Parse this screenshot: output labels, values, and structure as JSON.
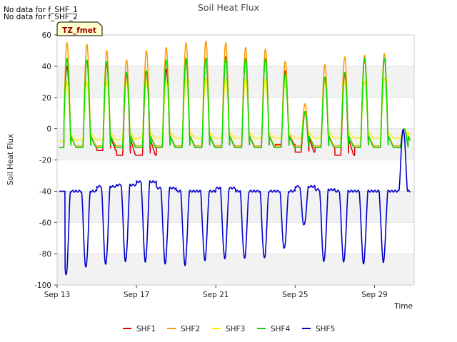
{
  "notes": [
    "No data for f_SHF_1",
    "No data for f_SHF_2"
  ],
  "badge": "TZ_fmet",
  "chart_data": {
    "type": "line",
    "title": "Soil Heat Flux",
    "xlabel": "Time",
    "ylabel": "Soil Heat Flux",
    "ylim": [
      -100,
      60
    ],
    "yticks": [
      -100,
      -80,
      -60,
      -40,
      -20,
      0,
      20,
      40,
      60
    ],
    "xlim": [
      "2023-09-13",
      "2023-10-01"
    ],
    "xticks": [
      "Sep 13",
      "Sep 17",
      "Sep 21",
      "Sep 25",
      "Sep 29"
    ],
    "xtick_dates": [
      "2023-09-13",
      "2023-09-17",
      "2023-09-21",
      "2023-09-25",
      "2023-09-29"
    ],
    "grid": "horizontal bands",
    "legend_position": "bottom",
    "series": [
      {
        "name": "SHF1",
        "color": "#dd0000",
        "daily_min": [
          -12,
          -12,
          -14,
          -17,
          -17,
          -12,
          -12,
          -12,
          -12,
          -12,
          -12,
          -10,
          -15,
          -12,
          -17,
          -12,
          -12,
          -12
        ],
        "daily_max": [
          40,
          44,
          42,
          35,
          37,
          38,
          44,
          45,
          46,
          45,
          45,
          37,
          10,
          33,
          35,
          45,
          45,
          0
        ]
      },
      {
        "name": "SHF2",
        "color": "#ff9900",
        "daily_min": [
          -12,
          -11,
          -11,
          -11,
          -11,
          -11,
          -11,
          -11,
          -11,
          -11,
          -11,
          -11,
          -11,
          -11,
          -11,
          -11,
          -11,
          -11
        ],
        "daily_max": [
          55,
          54,
          50,
          44,
          50,
          52,
          55,
          56,
          55,
          52,
          51,
          43,
          16,
          41,
          46,
          47,
          48,
          0
        ]
      },
      {
        "name": "SHF3",
        "color": "#ffee00",
        "daily_min": [
          -8,
          -7,
          -7,
          -7,
          -6,
          -6,
          -6,
          -6,
          -6,
          -6,
          -6,
          -6,
          -6,
          -6,
          -6,
          -6,
          -6,
          -6
        ],
        "daily_max": [
          30,
          30,
          30,
          30,
          30,
          30,
          32,
          32,
          32,
          32,
          32,
          30,
          10,
          30,
          30,
          30,
          32,
          0
        ]
      },
      {
        "name": "SHF4",
        "color": "#00dd00",
        "daily_min": [
          -12,
          -12,
          -12,
          -12,
          -12,
          -12,
          -12,
          -12,
          -12,
          -12,
          -12,
          -12,
          -12,
          -12,
          -12,
          -12,
          -12,
          -12
        ],
        "daily_max": [
          45,
          44,
          43,
          36,
          37,
          44,
          45,
          45,
          45,
          45,
          45,
          35,
          11,
          33,
          36,
          45,
          45,
          0
        ]
      },
      {
        "name": "SHF5",
        "color": "#0000cc",
        "daily_min": [
          -94,
          -89,
          -87,
          -85,
          -85,
          -86,
          -87,
          -84,
          -83,
          -83,
          -83,
          -77,
          -62,
          -85,
          -85,
          -86,
          -85,
          0
        ],
        "daily_max": [
          -40,
          -40,
          -37,
          -36,
          -34,
          -38,
          -40,
          -40,
          -38,
          -40,
          -40,
          -40,
          -37,
          -39,
          -40,
          -40,
          -40,
          -40
        ]
      }
    ]
  }
}
